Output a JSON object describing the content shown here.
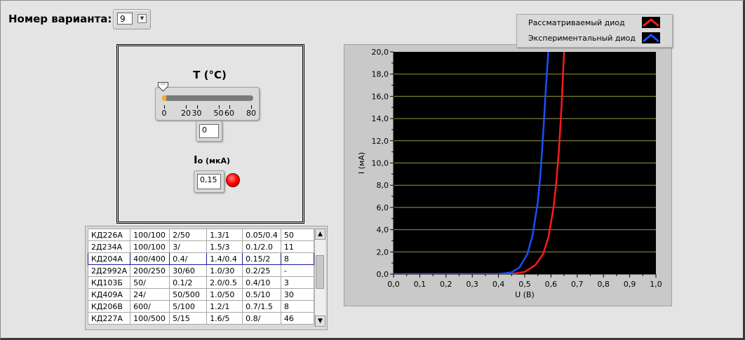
{
  "variant": {
    "label": "Номер варианта:",
    "value": "9"
  },
  "temperature": {
    "label": "T (°C)",
    "value": "0",
    "ticks": [
      "0",
      "20",
      "30",
      "50",
      "60",
      "80"
    ],
    "level": 0
  },
  "current": {
    "label_main": "I",
    "label_sub": "o (мкА)",
    "value": "0,15",
    "led_color": "#ff0000"
  },
  "table": {
    "rows": [
      [
        "КД226А",
        "100/100",
        "2/50",
        "1.3/1",
        "0.05/0.4",
        "50"
      ],
      [
        "2Д234А",
        "100/100",
        "3/",
        "1.5/3",
        "0.1/2.0",
        "11"
      ],
      [
        "КД204А",
        "400/400",
        "0.4/",
        "1.4/0.4",
        "0.15/2",
        "8"
      ],
      [
        "2Д2992А",
        "200/250",
        "30/60",
        "1.0/30",
        "0.2/25",
        "-"
      ],
      [
        "КД103Б",
        "50/",
        "0.1/2",
        "2.0/0.5",
        "0.4/10",
        "3"
      ],
      [
        "КД409А",
        "24/",
        "50/500",
        "1.0/50",
        "0.5/10",
        "30"
      ],
      [
        "КД206В",
        "600/",
        "5/100",
        "1.2/1",
        "0.7/1.5",
        "8"
      ],
      [
        "КД227А",
        "100/500",
        "5/15",
        "1.6/5",
        "0.8/",
        "46"
      ]
    ],
    "selected_row": 2
  },
  "chart_data": {
    "type": "line",
    "xlabel": "U (В)",
    "ylabel": "I (мА)",
    "xlim": [
      0,
      1.0
    ],
    "ylim": [
      0,
      20
    ],
    "x_ticks": [
      "0,0",
      "0,1",
      "0,2",
      "0,3",
      "0,4",
      "0,5",
      "0,6",
      "0,7",
      "0,8",
      "0,9",
      "1,0"
    ],
    "y_ticks": [
      "0,0",
      "2,0",
      "4,0",
      "6,0",
      "8,0",
      "10,0",
      "12,0",
      "14,0",
      "16,0",
      "18,0",
      "20,0"
    ],
    "grid": "horizontal",
    "background": "#000000",
    "legend_position": "top-right",
    "series": [
      {
        "name": "Рассматриваемый диод",
        "color": "#ff1a1a",
        "x": [
          0.0,
          0.45,
          0.5,
          0.54,
          0.57,
          0.59,
          0.61,
          0.62,
          0.63,
          0.64,
          0.65
        ],
        "y": [
          0.0,
          0.02,
          0.2,
          0.8,
          1.8,
          3.3,
          6.0,
          8.2,
          11.0,
          15.0,
          20.0
        ]
      },
      {
        "name": "Экспериментальный диод",
        "color": "#1a4fff",
        "x": [
          0.0,
          0.4,
          0.45,
          0.48,
          0.51,
          0.53,
          0.55,
          0.56,
          0.57,
          0.58,
          0.59
        ],
        "y": [
          0.0,
          0.02,
          0.15,
          0.6,
          1.8,
          3.5,
          6.5,
          9.0,
          12.5,
          16.5,
          20.0
        ]
      }
    ]
  }
}
